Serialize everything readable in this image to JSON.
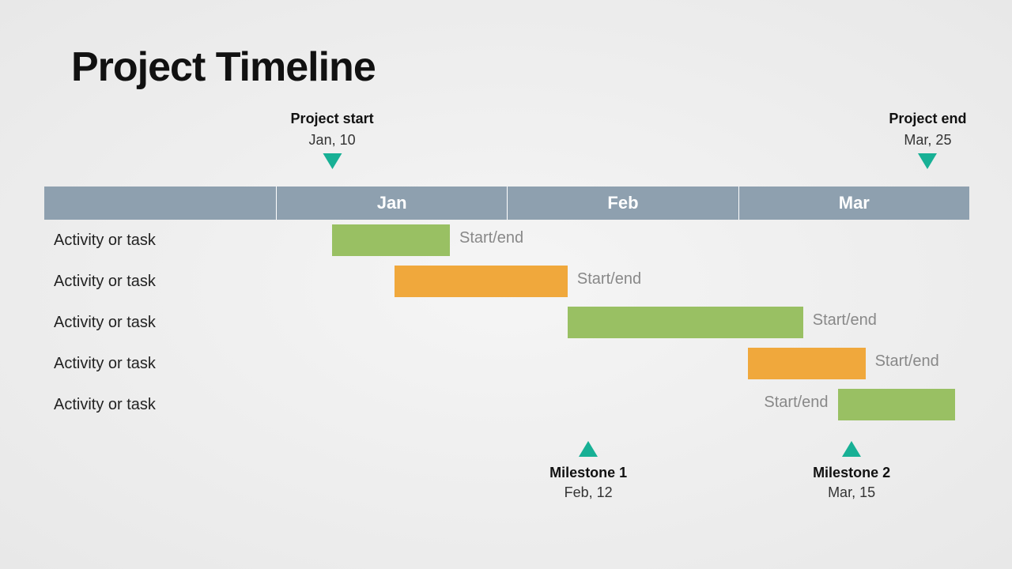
{
  "title": "Project Timeline",
  "months": [
    "Jan",
    "Feb",
    "Mar"
  ],
  "project": {
    "start_label": "Project start",
    "start_date": "Jan, 10",
    "end_label": "Project end",
    "end_date": "Mar, 25"
  },
  "rows": [
    {
      "label": "Activity or task",
      "caption": "Start/end",
      "color": "green",
      "start_pct": 8,
      "width_pct": 17,
      "caption_side": "right"
    },
    {
      "label": "Activity or task",
      "caption": "Start/end",
      "color": "orange",
      "start_pct": 17,
      "width_pct": 25,
      "caption_side": "right"
    },
    {
      "label": "Activity or task",
      "caption": "Start/end",
      "color": "green",
      "start_pct": 42,
      "width_pct": 34,
      "caption_side": "right"
    },
    {
      "label": "Activity or task",
      "caption": "Start/end",
      "color": "orange",
      "start_pct": 68,
      "width_pct": 17,
      "caption_side": "right"
    },
    {
      "label": "Activity or task",
      "caption": "Start/end",
      "color": "green",
      "start_pct": 81,
      "width_pct": 17,
      "caption_side": "left"
    }
  ],
  "milestones": [
    {
      "label": "Milestone 1",
      "date": "Feb, 12",
      "pos_pct": 45
    },
    {
      "label": "Milestone 2",
      "date": "Mar, 15",
      "pos_pct": 83
    }
  ],
  "project_start_pos_pct": 8,
  "project_end_pos_pct": 94
}
